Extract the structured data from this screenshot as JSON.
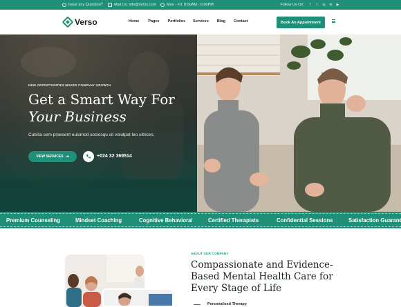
{
  "topbar": {
    "question": "Have any Question?",
    "mail": "Mail Us: info@verso.com",
    "hours": "Mon - Fri: 8:00AM - 6:00PM",
    "follow": "Follow Us On:",
    "social_icons": [
      "facebook-icon",
      "twitter-icon",
      "instagram-icon",
      "linkedin-icon",
      "youtube-icon"
    ],
    "social_glyphs": [
      "f",
      "t",
      "◎",
      "in",
      "▶"
    ]
  },
  "header": {
    "brand": "Verso",
    "nav": [
      "Home",
      "Pages",
      "Portfolios",
      "Services",
      "Blog",
      "Contact"
    ],
    "cta": "Book An Appointment"
  },
  "hero": {
    "kicker": "NEW OPPORTUNITIES MAKES COMPANY GROWTH",
    "title_line1": "Get a Smart Way For",
    "title_line2": "Your Business",
    "subtitle": "Cubilia sem praesent euismod sociosqu sit volutpat leo ultrices,",
    "button": "VIEW SERVICES",
    "phone": "+024 32 369514"
  },
  "ticker": {
    "items": [
      "Premium Counseling",
      "Mindset Coaching",
      "Cognitive Behavioral",
      "Certified Therapists",
      "Confidential Sessions",
      "Satisfaction Guarantee"
    ]
  },
  "about": {
    "kicker": "ABOUT OUR COMPANY",
    "title": "Compassionate and Evidence-Based Mental Health Care for Every Stage of Life",
    "list_item": "Personalized Therapy"
  },
  "colors": {
    "accent": "#1f8f77",
    "dark": "#17221f"
  }
}
